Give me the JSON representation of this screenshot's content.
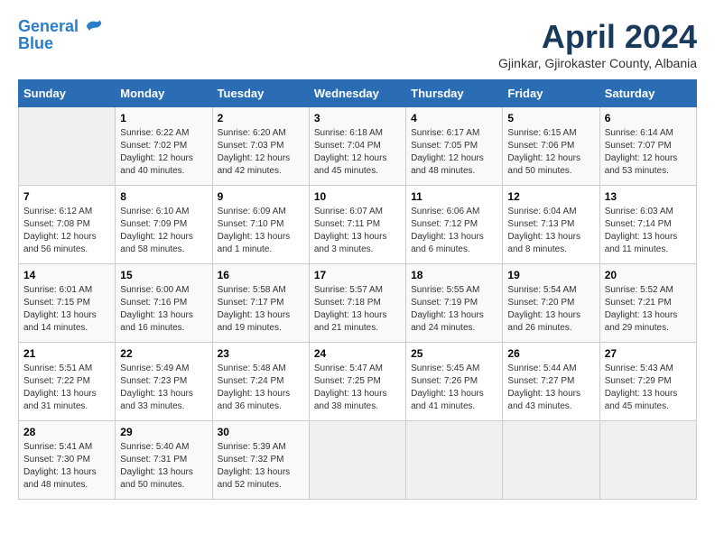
{
  "header": {
    "logo_line1": "General",
    "logo_line2": "Blue",
    "month": "April 2024",
    "location": "Gjinkar, Gjirokaster County, Albania"
  },
  "days_of_week": [
    "Sunday",
    "Monday",
    "Tuesday",
    "Wednesday",
    "Thursday",
    "Friday",
    "Saturday"
  ],
  "weeks": [
    [
      {
        "day": "",
        "info": ""
      },
      {
        "day": "1",
        "info": "Sunrise: 6:22 AM\nSunset: 7:02 PM\nDaylight: 12 hours\nand 40 minutes."
      },
      {
        "day": "2",
        "info": "Sunrise: 6:20 AM\nSunset: 7:03 PM\nDaylight: 12 hours\nand 42 minutes."
      },
      {
        "day": "3",
        "info": "Sunrise: 6:18 AM\nSunset: 7:04 PM\nDaylight: 12 hours\nand 45 minutes."
      },
      {
        "day": "4",
        "info": "Sunrise: 6:17 AM\nSunset: 7:05 PM\nDaylight: 12 hours\nand 48 minutes."
      },
      {
        "day": "5",
        "info": "Sunrise: 6:15 AM\nSunset: 7:06 PM\nDaylight: 12 hours\nand 50 minutes."
      },
      {
        "day": "6",
        "info": "Sunrise: 6:14 AM\nSunset: 7:07 PM\nDaylight: 12 hours\nand 53 minutes."
      }
    ],
    [
      {
        "day": "7",
        "info": "Sunrise: 6:12 AM\nSunset: 7:08 PM\nDaylight: 12 hours\nand 56 minutes."
      },
      {
        "day": "8",
        "info": "Sunrise: 6:10 AM\nSunset: 7:09 PM\nDaylight: 12 hours\nand 58 minutes."
      },
      {
        "day": "9",
        "info": "Sunrise: 6:09 AM\nSunset: 7:10 PM\nDaylight: 13 hours\nand 1 minute."
      },
      {
        "day": "10",
        "info": "Sunrise: 6:07 AM\nSunset: 7:11 PM\nDaylight: 13 hours\nand 3 minutes."
      },
      {
        "day": "11",
        "info": "Sunrise: 6:06 AM\nSunset: 7:12 PM\nDaylight: 13 hours\nand 6 minutes."
      },
      {
        "day": "12",
        "info": "Sunrise: 6:04 AM\nSunset: 7:13 PM\nDaylight: 13 hours\nand 8 minutes."
      },
      {
        "day": "13",
        "info": "Sunrise: 6:03 AM\nSunset: 7:14 PM\nDaylight: 13 hours\nand 11 minutes."
      }
    ],
    [
      {
        "day": "14",
        "info": "Sunrise: 6:01 AM\nSunset: 7:15 PM\nDaylight: 13 hours\nand 14 minutes."
      },
      {
        "day": "15",
        "info": "Sunrise: 6:00 AM\nSunset: 7:16 PM\nDaylight: 13 hours\nand 16 minutes."
      },
      {
        "day": "16",
        "info": "Sunrise: 5:58 AM\nSunset: 7:17 PM\nDaylight: 13 hours\nand 19 minutes."
      },
      {
        "day": "17",
        "info": "Sunrise: 5:57 AM\nSunset: 7:18 PM\nDaylight: 13 hours\nand 21 minutes."
      },
      {
        "day": "18",
        "info": "Sunrise: 5:55 AM\nSunset: 7:19 PM\nDaylight: 13 hours\nand 24 minutes."
      },
      {
        "day": "19",
        "info": "Sunrise: 5:54 AM\nSunset: 7:20 PM\nDaylight: 13 hours\nand 26 minutes."
      },
      {
        "day": "20",
        "info": "Sunrise: 5:52 AM\nSunset: 7:21 PM\nDaylight: 13 hours\nand 29 minutes."
      }
    ],
    [
      {
        "day": "21",
        "info": "Sunrise: 5:51 AM\nSunset: 7:22 PM\nDaylight: 13 hours\nand 31 minutes."
      },
      {
        "day": "22",
        "info": "Sunrise: 5:49 AM\nSunset: 7:23 PM\nDaylight: 13 hours\nand 33 minutes."
      },
      {
        "day": "23",
        "info": "Sunrise: 5:48 AM\nSunset: 7:24 PM\nDaylight: 13 hours\nand 36 minutes."
      },
      {
        "day": "24",
        "info": "Sunrise: 5:47 AM\nSunset: 7:25 PM\nDaylight: 13 hours\nand 38 minutes."
      },
      {
        "day": "25",
        "info": "Sunrise: 5:45 AM\nSunset: 7:26 PM\nDaylight: 13 hours\nand 41 minutes."
      },
      {
        "day": "26",
        "info": "Sunrise: 5:44 AM\nSunset: 7:27 PM\nDaylight: 13 hours\nand 43 minutes."
      },
      {
        "day": "27",
        "info": "Sunrise: 5:43 AM\nSunset: 7:29 PM\nDaylight: 13 hours\nand 45 minutes."
      }
    ],
    [
      {
        "day": "28",
        "info": "Sunrise: 5:41 AM\nSunset: 7:30 PM\nDaylight: 13 hours\nand 48 minutes."
      },
      {
        "day": "29",
        "info": "Sunrise: 5:40 AM\nSunset: 7:31 PM\nDaylight: 13 hours\nand 50 minutes."
      },
      {
        "day": "30",
        "info": "Sunrise: 5:39 AM\nSunset: 7:32 PM\nDaylight: 13 hours\nand 52 minutes."
      },
      {
        "day": "",
        "info": ""
      },
      {
        "day": "",
        "info": ""
      },
      {
        "day": "",
        "info": ""
      },
      {
        "day": "",
        "info": ""
      }
    ]
  ]
}
